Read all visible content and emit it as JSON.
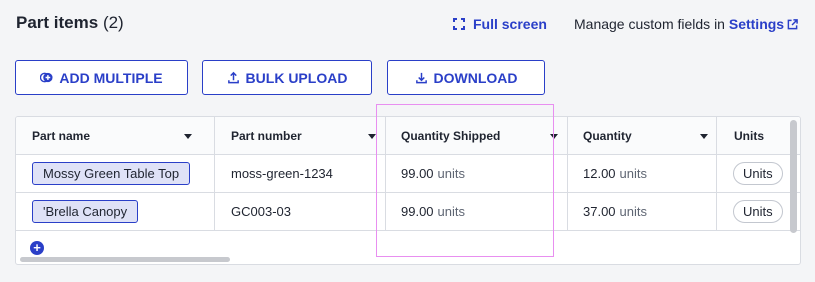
{
  "header": {
    "title": "Part items",
    "count": "(2)",
    "fullscreen_label": "Full screen",
    "manage_text": "Manage custom fields in",
    "settings_label": "Settings"
  },
  "toolbar": {
    "add_multiple_label": "ADD MULTIPLE",
    "bulk_upload_label": "BULK UPLOAD",
    "download_label": "DOWNLOAD"
  },
  "table": {
    "columns": [
      "Part name",
      "Part number",
      "Quantity Shipped",
      "Quantity",
      "Units"
    ],
    "rows": [
      {
        "part_name": "Mossy Green Table Top",
        "part_number": "moss-green-1234",
        "qty_shipped": "99.00",
        "qty_shipped_unit": "units",
        "quantity": "12.00",
        "quantity_unit": "units",
        "units": "Units"
      },
      {
        "part_name": "'Brella Canopy",
        "part_number": "GC003-03",
        "qty_shipped": "99.00",
        "qty_shipped_unit": "units",
        "quantity": "37.00",
        "quantity_unit": "units",
        "units": "Units"
      }
    ],
    "add_row_icon": "plus-circle-icon"
  },
  "colors": {
    "accent": "#2a3fc8",
    "highlight": "#e88ff0"
  }
}
